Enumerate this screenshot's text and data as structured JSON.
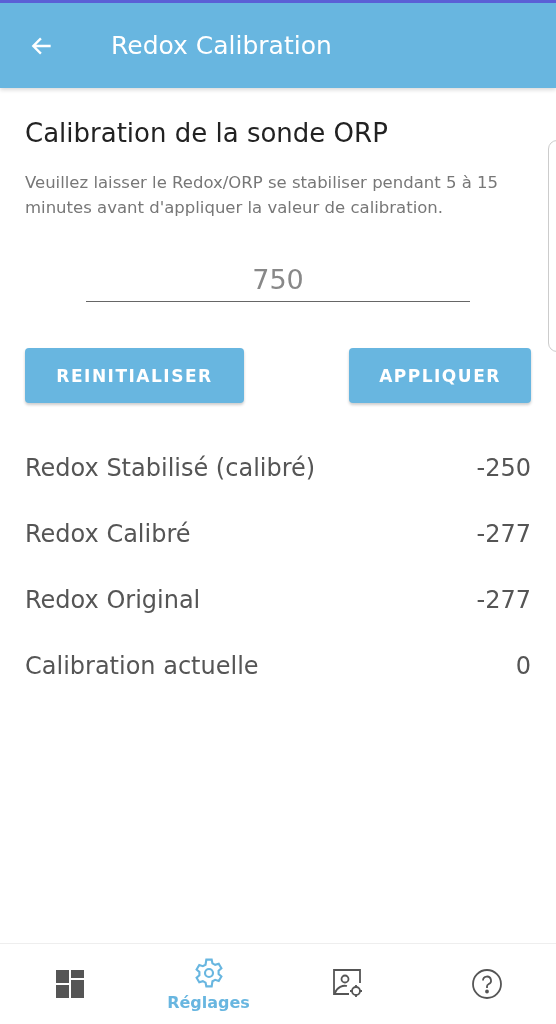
{
  "app_bar": {
    "title": "Redox Calibration"
  },
  "heading": "Calibration de la sonde ORP",
  "description": "Veuillez laisser le Redox/ORP se stabiliser pendant 5 à 15 minutes avant d'appliquer la valeur de calibration.",
  "calibration_field": {
    "placeholder": "750"
  },
  "buttons": [
    {
      "label": "REINITIALISER"
    },
    {
      "label": "APPLIQUER"
    }
  ],
  "readings": [
    {
      "label": "Redox Stabilisé (calibré)",
      "value": "-250"
    },
    {
      "label": "Redox Calibré",
      "value": "-277"
    },
    {
      "label": "Redox Original",
      "value": "-277"
    },
    {
      "label": "Calibration actuelle",
      "value": "0"
    }
  ],
  "bottom_nav": [
    {
      "kind": "dashboard",
      "selected": false
    },
    {
      "kind": "settings",
      "label": "Réglages",
      "selected": true
    },
    {
      "kind": "profile",
      "selected": false
    },
    {
      "kind": "help",
      "selected": false
    }
  ]
}
